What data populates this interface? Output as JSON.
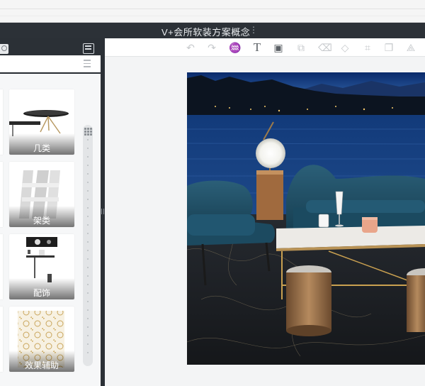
{
  "app": {
    "title": "V+会所软装方案概念",
    "more_icon": "more-vertical-icon"
  },
  "left_panel": {
    "search_icon": "search-icon",
    "view_toggle_icon": "grid-view-icon",
    "sort_icon": "sort-icon",
    "categories": [
      {
        "label": "几类"
      },
      {
        "label": "架类"
      },
      {
        "label": "配饰"
      },
      {
        "label": "效果辅助"
      }
    ],
    "index_bar_icon": "grid-icon"
  },
  "toolbar": {
    "tools": [
      {
        "name": "undo-icon",
        "glyph": "↶",
        "enabled": false
      },
      {
        "name": "redo-icon",
        "glyph": "↷",
        "enabled": false
      },
      {
        "name": "brush-icon",
        "glyph": "♒",
        "enabled": true
      },
      {
        "name": "text-icon",
        "glyph": "T",
        "enabled": true
      },
      {
        "name": "image-icon",
        "glyph": "▣",
        "enabled": true
      },
      {
        "name": "replace-image-icon",
        "glyph": "⧉",
        "enabled": false
      },
      {
        "name": "delete-icon",
        "glyph": "🗑",
        "enabled": false
      },
      {
        "name": "transform-icon",
        "glyph": "◇",
        "enabled": false
      },
      {
        "name": "crop-icon",
        "glyph": "⌗",
        "enabled": false
      },
      {
        "name": "copy-icon",
        "glyph": "❐",
        "enabled": false
      },
      {
        "name": "flip-icon",
        "glyph": "⟁",
        "enabled": false
      }
    ]
  },
  "colors": {
    "titlebar": "#2c3137",
    "panel": "#2b3036",
    "canvas_bg": "#f3f4f5",
    "lake": "#1e4a8a",
    "sofa": "#1f4f66",
    "brass": "#a87a4e"
  }
}
